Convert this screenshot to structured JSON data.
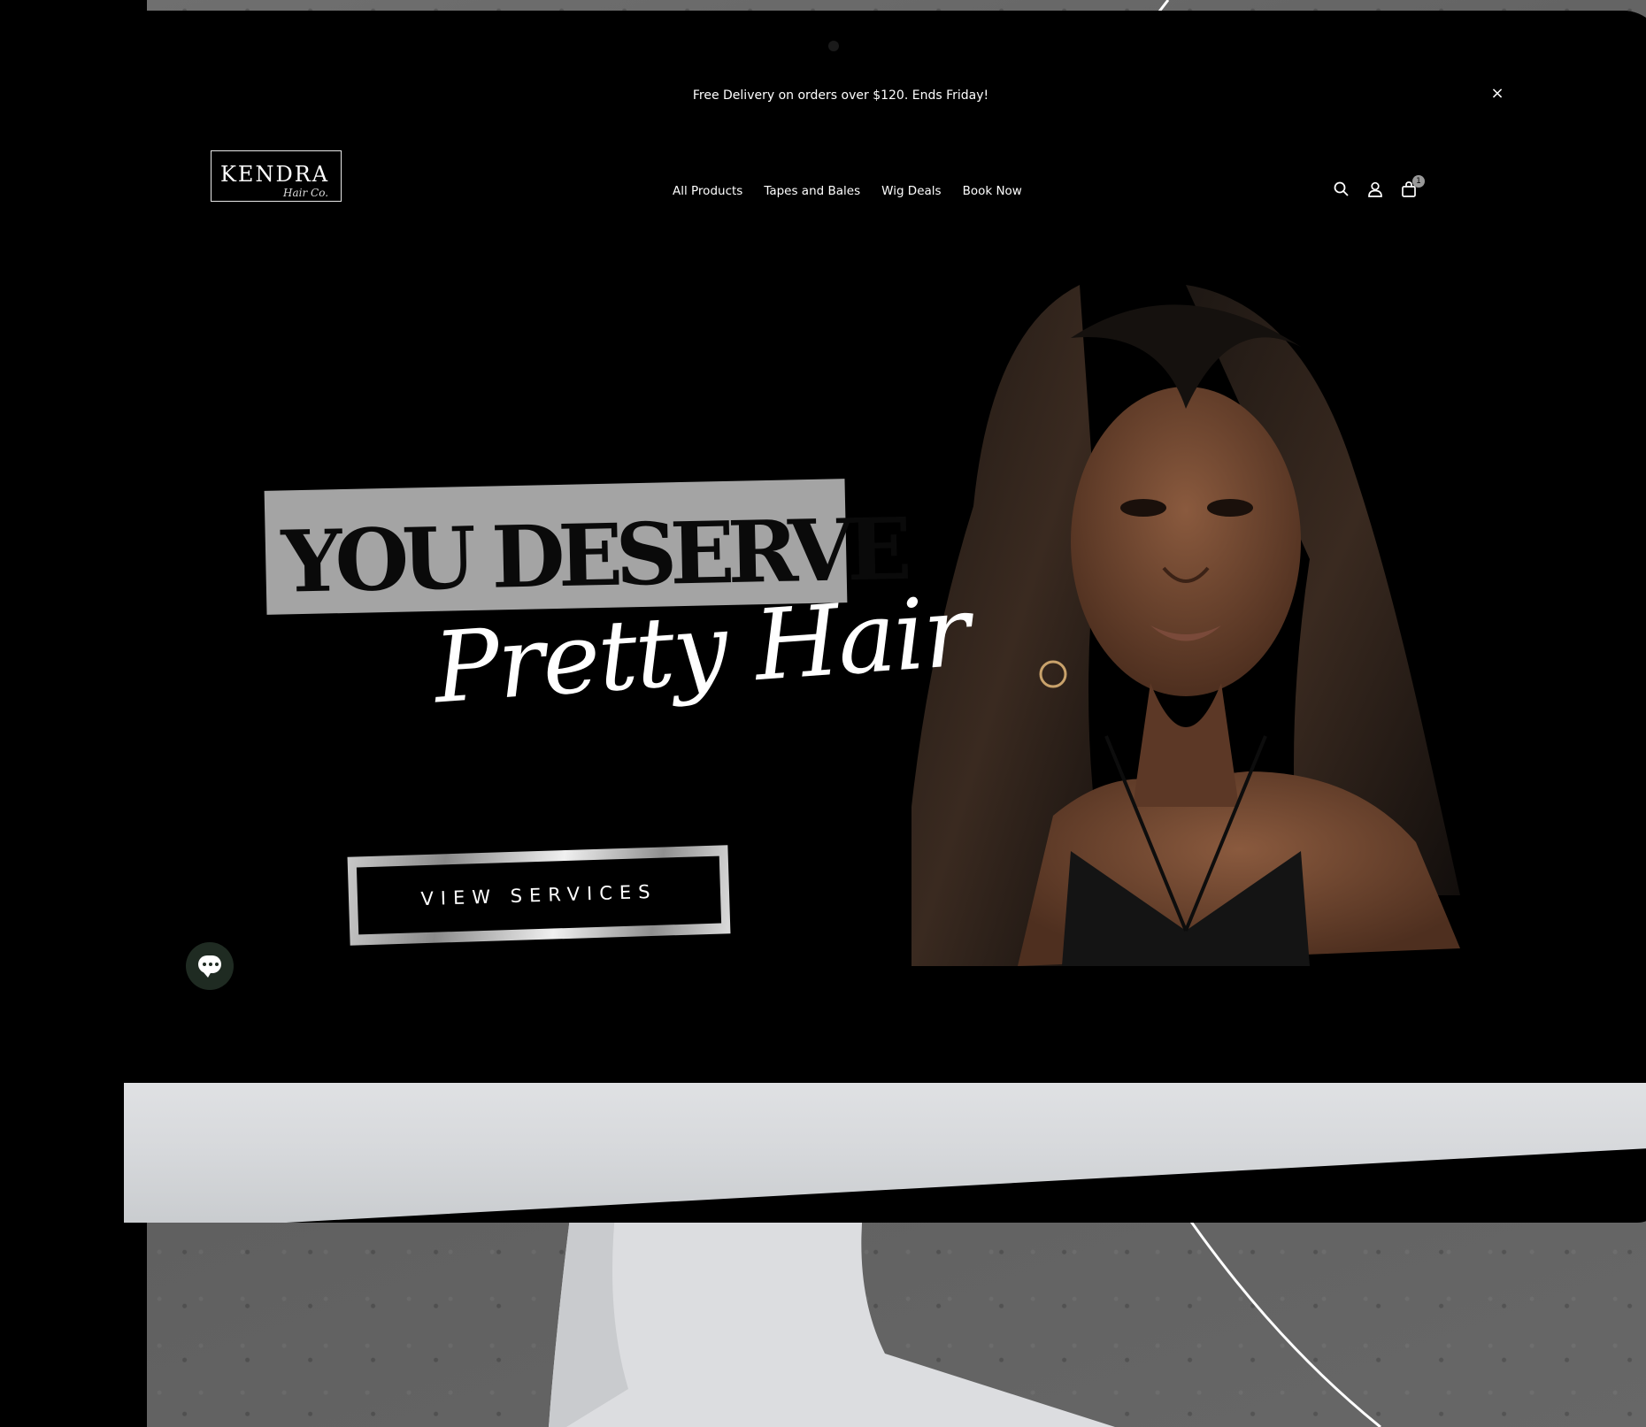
{
  "announcement": {
    "text": "Free Delivery on orders over $120. Ends Friday!",
    "close_icon": "close-icon",
    "close_glyph": "×"
  },
  "brand": {
    "name": "KENDRA",
    "sub": "Hair Co."
  },
  "nav": {
    "items": [
      {
        "label": "All Products"
      },
      {
        "label": "Tapes and Bales"
      },
      {
        "label": "Wig Deals"
      },
      {
        "label": "Book Now"
      }
    ]
  },
  "header_icons": {
    "search": "search-icon",
    "account": "account-icon",
    "cart": "cart-icon",
    "cart_count": "1"
  },
  "hero": {
    "headline": "YOU DESERVE",
    "script": "Pretty Hair",
    "cta": "VIEW SERVICES",
    "photo": "woman-portrait-image"
  },
  "chat": {
    "icon": "chat-bubble-icon"
  },
  "colors": {
    "background": "#000000",
    "headline_box": "#a4a4a4",
    "text": "#ffffff",
    "chat": "#1f2b22",
    "wall": "#666666",
    "monitor_chin": "#dcdee1"
  }
}
